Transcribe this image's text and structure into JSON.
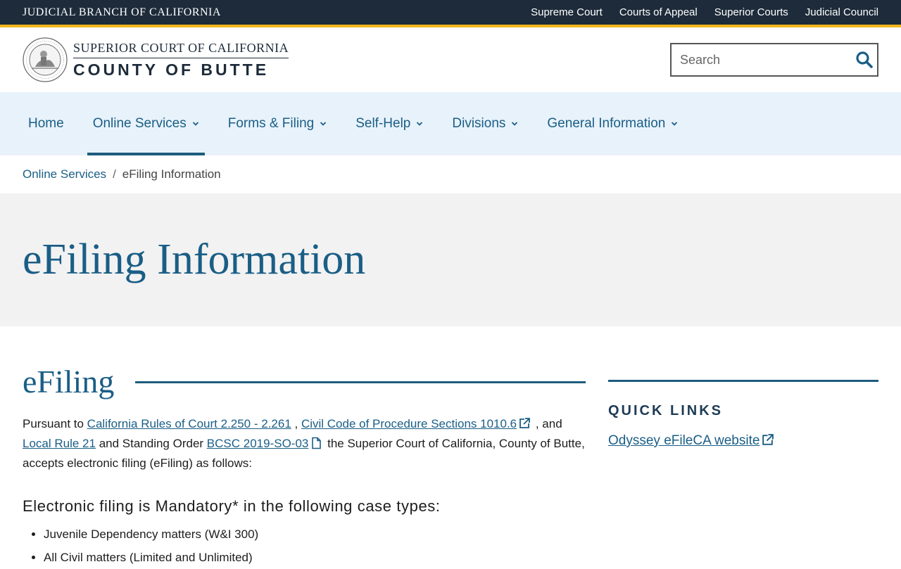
{
  "topbar": {
    "brand": "JUDICIAL BRANCH OF CALIFORNIA",
    "links": [
      "Supreme Court",
      "Courts of Appeal",
      "Superior Courts",
      "Judicial Council"
    ]
  },
  "header": {
    "logo_line1": "SUPERIOR COURT OF CALIFORNIA",
    "logo_line2": "COUNTY OF BUTTE",
    "seal_text": "JUDICIAL BRANCH OF CALIFORNIA",
    "search_placeholder": "Search"
  },
  "nav": {
    "items": [
      {
        "label": "Home",
        "dropdown": false,
        "active": false
      },
      {
        "label": "Online Services",
        "dropdown": true,
        "active": true
      },
      {
        "label": "Forms & Filing",
        "dropdown": true,
        "active": false
      },
      {
        "label": "Self-Help",
        "dropdown": true,
        "active": false
      },
      {
        "label": "Divisions",
        "dropdown": true,
        "active": false
      },
      {
        "label": "General Information",
        "dropdown": true,
        "active": false
      }
    ]
  },
  "breadcrumb": {
    "parent": "Online Services",
    "separator": "/",
    "current": "eFiling Information"
  },
  "hero": {
    "title": "eFiling Information"
  },
  "main": {
    "section_title": "eFiling",
    "para": {
      "t1": "Pursuant to ",
      "link1": "California Rules of Court 2.250 - 2.261",
      "t2": " , ",
      "link2": "Civil Code of Procedure Sections 1010.6",
      "t3": " , and ",
      "link3": "Local Rule 21",
      "t4": " and Standing Order ",
      "link4": "BCSC 2019-SO-03",
      "t5": " the Superior Court of California, County of Butte, accepts electronic filing (eFiling) as follows:"
    },
    "subhead": "Electronic filing is Mandatory* in the following case types:",
    "list": [
      "Juvenile Dependency matters (W&I 300)",
      "All Civil matters (Limited and Unlimited)"
    ]
  },
  "sidebar": {
    "title": "QUICK LINKS",
    "link": "Odyssey eFileCA website"
  },
  "colors": {
    "topbar_bg": "#1d2b3a",
    "accent_gold": "#f2b51c",
    "brand_blue": "#1a5e86",
    "nav_bg": "#e8f2fa",
    "hero_bg": "#f2f2f2"
  }
}
